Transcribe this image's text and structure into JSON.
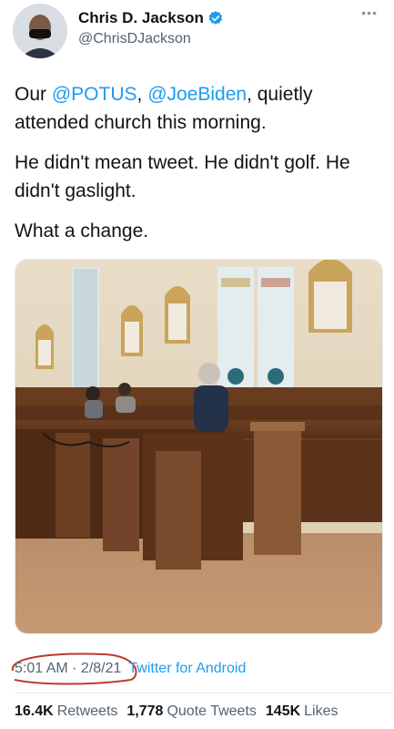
{
  "author": {
    "display_name": "Chris D. Jackson",
    "handle": "@ChrisDJackson",
    "verified_icon": "verified-badge-icon",
    "more_icon": "more-options-icon"
  },
  "tweet": {
    "line1_prefix": "Our ",
    "mention1": "@POTUS",
    "line1_sep": ", ",
    "mention2": "@JoeBiden",
    "line1_suffix": ", quietly attended church this morning.",
    "paragraph2": "He didn't mean tweet. He didn't golf. He didn't gaslight.",
    "paragraph3": "What a change."
  },
  "meta": {
    "time": "5:01 AM",
    "separator": " · ",
    "date": "2/8/21",
    "source": "Twitter for Android",
    "annotation_color": "#c0392b"
  },
  "stats": {
    "retweets_count": "16.4K",
    "retweets_label": "Retweets",
    "quotes_count": "1,778",
    "quotes_label": "Quote Tweets",
    "likes_count": "145K",
    "likes_label": "Likes"
  },
  "colors": {
    "accent": "#1d9bf0",
    "secondary_text": "#536471"
  }
}
